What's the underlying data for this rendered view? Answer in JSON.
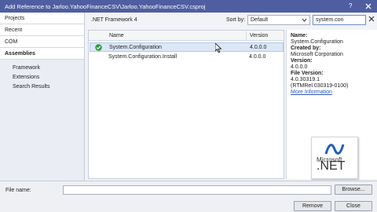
{
  "window": {
    "title": "Add Reference to Jarloo.YahooFinanceCSV\\Jarloo.YahooFinanceCSV.csproj",
    "help_glyph": "?",
    "close_icon": "close-icon"
  },
  "sidebar": {
    "categories": [
      {
        "label": "Projects"
      },
      {
        "label": "Recent"
      },
      {
        "label": "COM"
      },
      {
        "label": "Assemblies"
      }
    ],
    "subitems": [
      {
        "label": "Framework"
      },
      {
        "label": "Extensions"
      },
      {
        "label": "Search Results"
      }
    ]
  },
  "main": {
    "framework_label": ".NET Framework 4",
    "sort_by_label": "Sort by:",
    "sort_value": "Default",
    "search_value": "system.con",
    "columns": {
      "name": "Name",
      "version": "Version"
    },
    "rows": [
      {
        "name": "System.Configuration",
        "version": "4.0.0.0",
        "selected": true,
        "checked": true
      },
      {
        "name": "System.Configuration.Install",
        "version": "4.0.0.0",
        "selected": false,
        "checked": false
      }
    ]
  },
  "details": {
    "name_label": "Name:",
    "name_value": "System.Configuration",
    "created_by_label": "Created by:",
    "created_by_value": "Microsoft Corporation",
    "version_label": "Version:",
    "version_value": "4.0.0.0",
    "file_version_label": "File Version:",
    "file_version_value": "4.0.30319.1",
    "file_version_extra": "(RTMRel.030319-0100)",
    "more_info": "More Information",
    "logo_company": "Microsoft",
    "logo_product": ".NET"
  },
  "footer": {
    "file_name_label": "File name:",
    "file_name_value": "",
    "browse": "Browse...",
    "remove": "Remove",
    "close": "Close"
  },
  "colors": {
    "titlebar": "#4e5ea0",
    "selection": "#dbe6f6",
    "link": "#2b56b8",
    "check_green": "#2e9b3a"
  }
}
